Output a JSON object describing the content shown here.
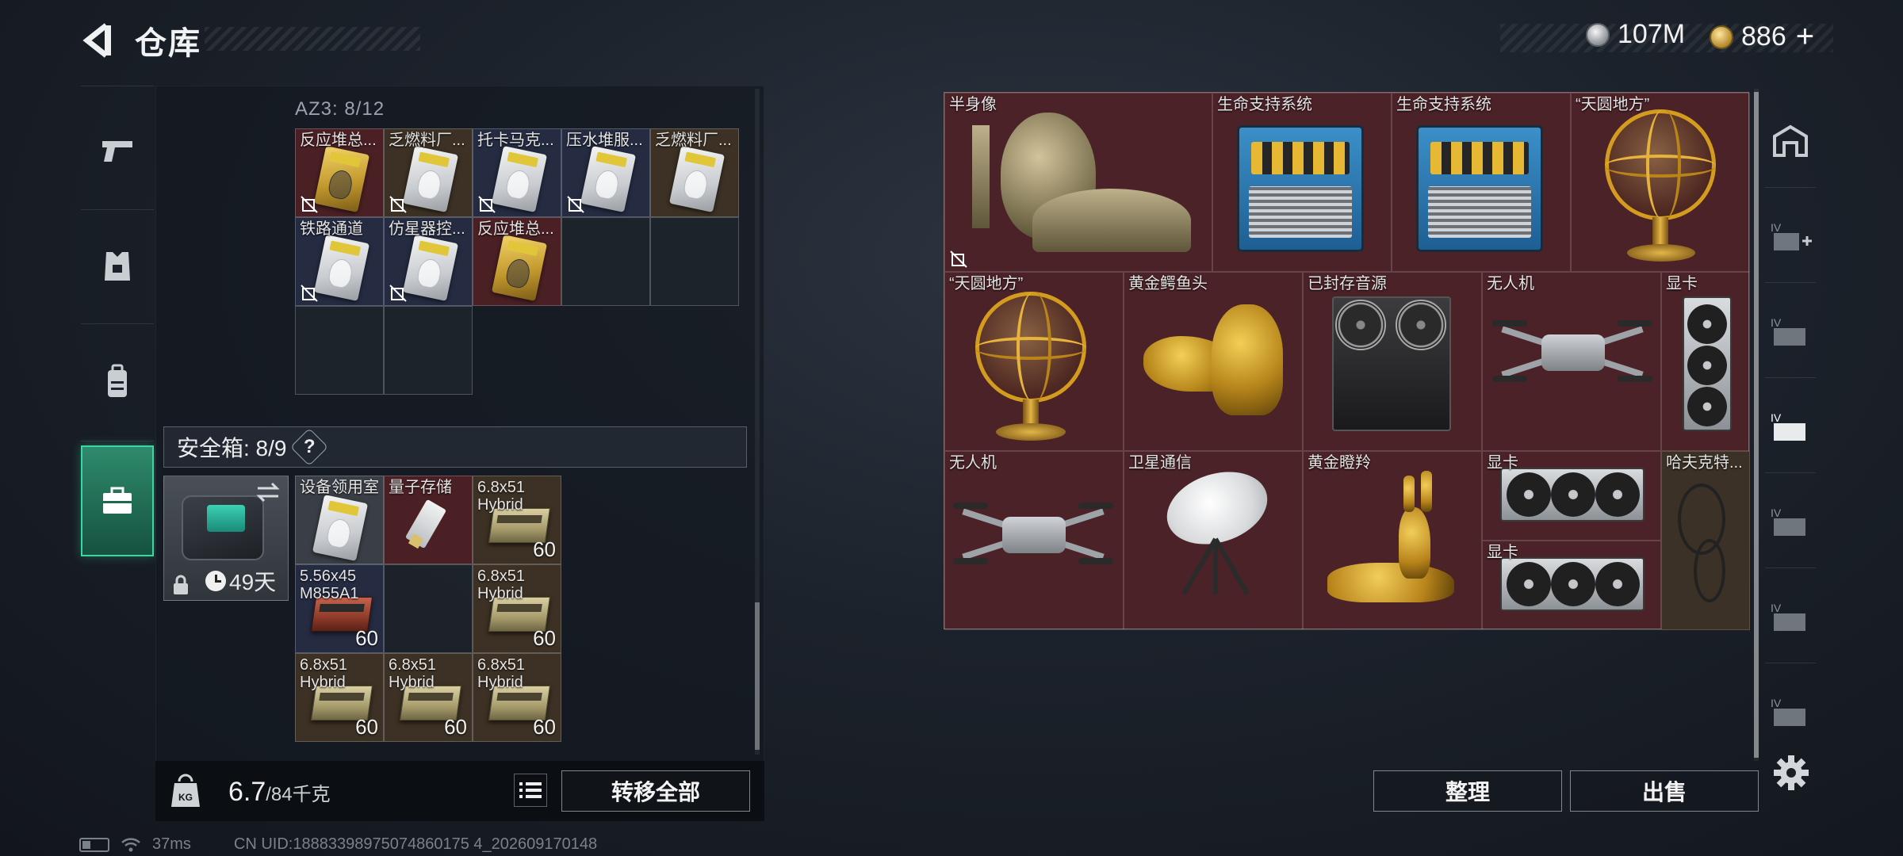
{
  "header": {
    "title": "仓库"
  },
  "currency": {
    "silver": "107M",
    "gold": "886",
    "add_symbol": "+"
  },
  "sidebar": {
    "tabs": [
      {
        "icon": "pistol-icon"
      },
      {
        "icon": "armor-icon"
      },
      {
        "icon": "backpack-icon"
      },
      {
        "icon": "toolbox-icon",
        "active": true
      }
    ]
  },
  "container": {
    "label": "AZ3: 8/12",
    "items": [
      {
        "name": "反应堆总...",
        "style": "gold"
      },
      {
        "name": "乏燃料厂...",
        "style": "white"
      },
      {
        "name": "托卡马克...",
        "style": "white"
      },
      {
        "name": "压水堆服...",
        "style": "white"
      },
      {
        "name": "乏燃料厂...",
        "style": "white"
      },
      {
        "name": "铁路通道",
        "style": "white"
      },
      {
        "name": "仿星器控...",
        "style": "white"
      },
      {
        "name": "反应堆总...",
        "style": "gold"
      }
    ]
  },
  "safebox": {
    "label": "安全箱: 8/9",
    "help": "?",
    "remaining_time": "49天",
    "items": [
      {
        "name": "设备领用室",
        "count": ""
      },
      {
        "name": "量子存储",
        "count": ""
      },
      {
        "name": "6.8x51 Hybrid",
        "count": "60"
      },
      {
        "name": "5.56x45 M855A1",
        "count": "60"
      },
      {
        "name": "6.8x51 Hybrid",
        "count": "60"
      },
      {
        "name": "6.8x51 Hybrid",
        "count": "60"
      },
      {
        "name": "6.8x51 Hybrid",
        "count": "60"
      },
      {
        "name": "6.8x51 Hybrid",
        "count": "60"
      }
    ]
  },
  "weight": {
    "current": "6.7",
    "max": "/84千克",
    "icon_label": "KG"
  },
  "actions": {
    "transfer_all": "转移全部",
    "organize": "整理",
    "sell": "出售"
  },
  "stash": {
    "items": [
      {
        "name": "半身像"
      },
      {
        "name": "生命支持系统"
      },
      {
        "name": "生命支持系统"
      },
      {
        "name": "“天圆地方”"
      },
      {
        "name": "“天圆地方”"
      },
      {
        "name": "黄金鳄鱼头"
      },
      {
        "name": "已封存音源"
      },
      {
        "name": "无人机"
      },
      {
        "name": "显卡"
      },
      {
        "name": "无人机"
      },
      {
        "name": "卫星通信"
      },
      {
        "name": "黄金瞪羚"
      },
      {
        "name": "显卡"
      },
      {
        "name": "显卡"
      },
      {
        "name": "哈夫克特..."
      }
    ]
  },
  "right_tabs": [
    {
      "icon": "home-stash-icon"
    },
    {
      "icon": "stash-iv-add-icon"
    },
    {
      "icon": "stash-iv-1-icon"
    },
    {
      "icon": "stash-iv-2-icon"
    },
    {
      "icon": "stash-iv-3-icon"
    },
    {
      "icon": "stash-iv-4-icon"
    },
    {
      "icon": "stash-iv-5-icon"
    }
  ],
  "status": {
    "ping": "37ms",
    "uid": "CN UID:18883398975074860175 4_202609170148"
  },
  "colors": {
    "accent": "#3bd6a1",
    "stash_bg": "#4a2227"
  }
}
